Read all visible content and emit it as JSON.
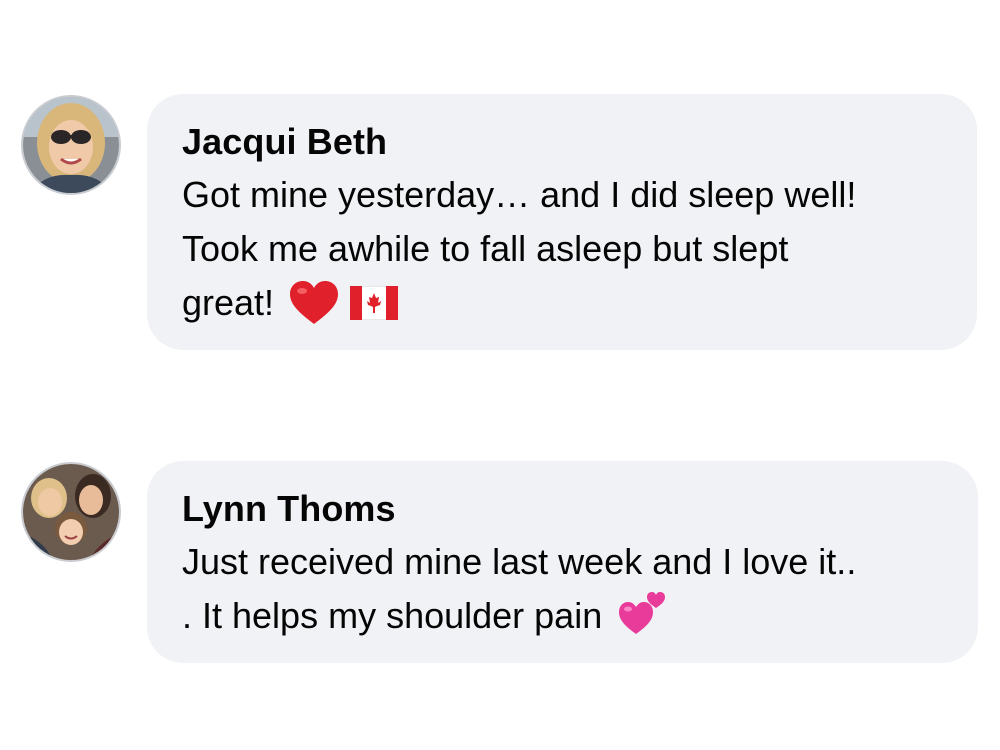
{
  "comments": [
    {
      "author": "Jacqui Beth",
      "text_line1": "Got mine yesterday… and I did sleep well!",
      "text_line2": "Took me awhile to fall asleep but slept",
      "text_line3": "great!",
      "emojis": [
        "red-heart-icon",
        "canada-flag-icon"
      ]
    },
    {
      "author": "Lynn Thoms",
      "text_line1": "Just received mine last week and I love it..",
      "text_line2": ". It helps my shoulder pain",
      "emojis": [
        "two-hearts-icon"
      ]
    }
  ],
  "colors": {
    "bubble_bg": "#f0f2f5",
    "text": "#050505",
    "avatar_border": "#c9ccd1",
    "heart_red": "#e0202a",
    "heart_pink": "#e83b9a"
  }
}
